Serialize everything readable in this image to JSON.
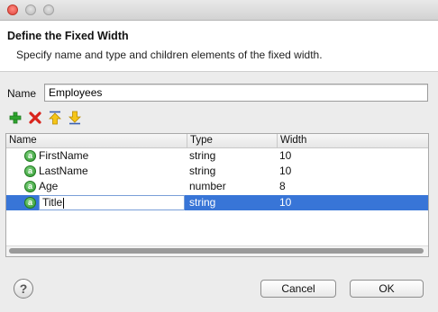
{
  "window": {
    "controls": [
      "close",
      "minimize",
      "zoom"
    ]
  },
  "header": {
    "title": "Define the Fixed Width",
    "description": "Specify name and type and children elements of the fixed width."
  },
  "form": {
    "name_label": "Name",
    "name_value": "Employees"
  },
  "toolbar": {
    "icons": [
      "add-icon",
      "delete-icon",
      "move-up-icon",
      "move-down-icon"
    ]
  },
  "table": {
    "columns": [
      "Name",
      "Type",
      "Width"
    ],
    "rows": [
      {
        "icon": "a",
        "name": "FirstName",
        "type": "string",
        "width": "10"
      },
      {
        "icon": "a",
        "name": "LastName",
        "type": "string",
        "width": "10"
      },
      {
        "icon": "a",
        "name": "Age",
        "type": "number",
        "width": "8"
      },
      {
        "icon": "a",
        "name": "Title",
        "type": "string",
        "width": "10",
        "selected": true,
        "editing": true
      }
    ]
  },
  "footer": {
    "help_glyph": "?",
    "cancel_label": "Cancel",
    "ok_label": "OK"
  },
  "colors": {
    "selection": "#3875d7",
    "attribute_icon": "#2f9a2f",
    "delete": "#d9241c",
    "move": "#f0b400"
  }
}
